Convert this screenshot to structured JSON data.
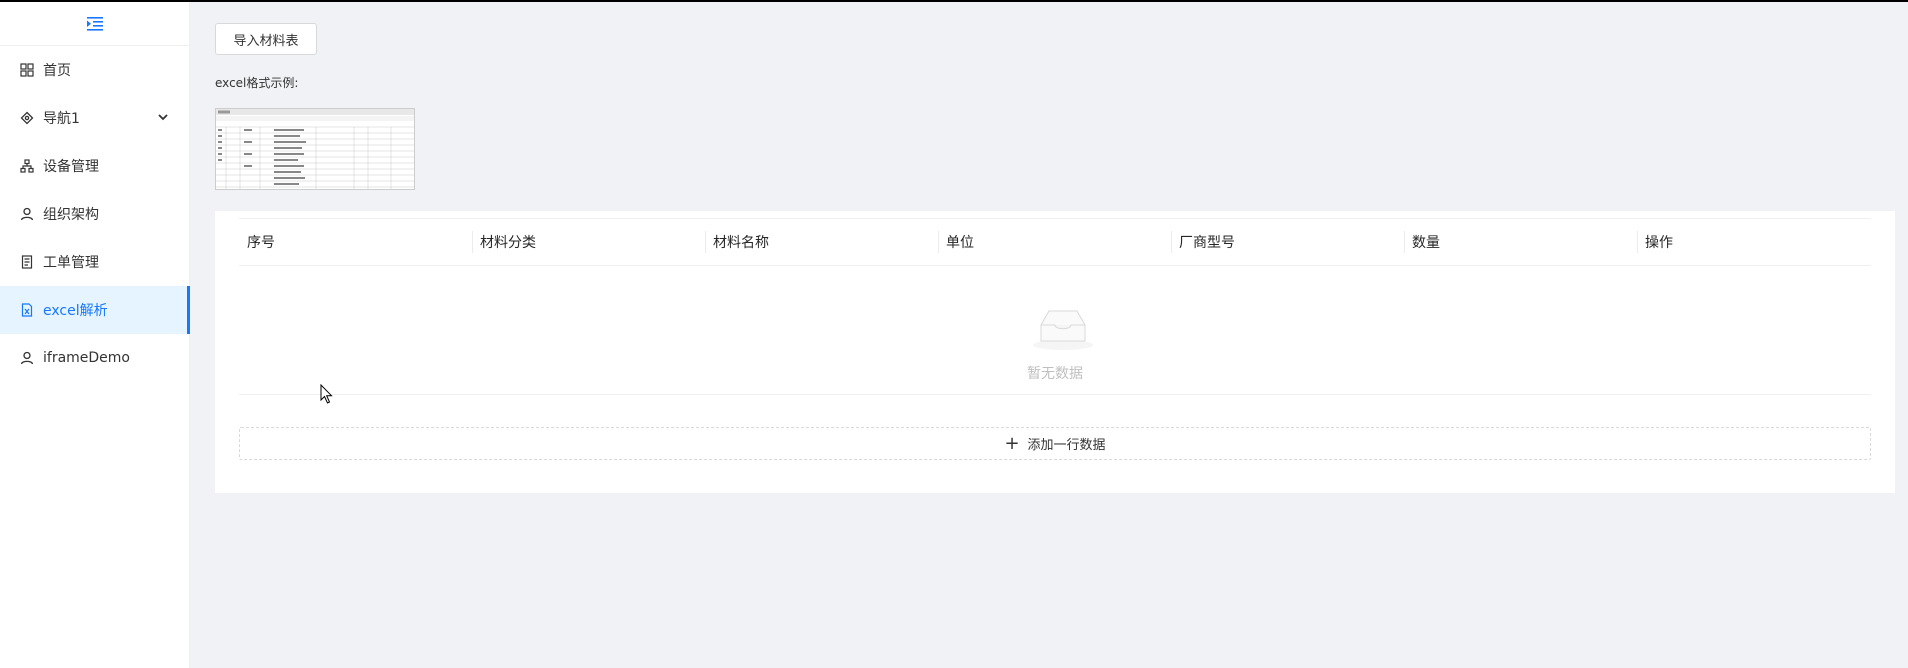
{
  "sidebar": {
    "items": [
      {
        "label": "首页",
        "icon": "grid-icon"
      },
      {
        "label": "导航1",
        "icon": "compass-icon",
        "expandable": true
      },
      {
        "label": "设备管理",
        "icon": "org-chart-icon"
      },
      {
        "label": "组织架构",
        "icon": "user-icon"
      },
      {
        "label": "工单管理",
        "icon": "file-icon"
      },
      {
        "label": "excel解析",
        "icon": "excel-file-icon",
        "active": true
      },
      {
        "label": "iframeDemo",
        "icon": "user-icon"
      }
    ]
  },
  "main": {
    "import_button": "导入材料表",
    "example_label": "excel格式示例:",
    "table": {
      "columns": [
        "序号",
        "材料分类",
        "材料名称",
        "单位",
        "厂商型号",
        "数量",
        "操作"
      ],
      "empty_text": "暂无数据",
      "add_row_label": "添加一行数据"
    }
  },
  "colors": {
    "accent": "#1677ff",
    "active_bg": "#e6f4ff",
    "page_bg": "#f0f2f5"
  }
}
